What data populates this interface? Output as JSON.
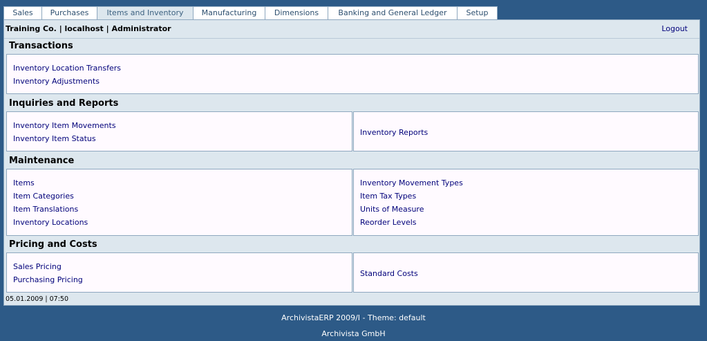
{
  "tabs": [
    "Sales",
    "Purchases",
    "Items and Inventory",
    "Manufacturing",
    "Dimensions",
    "Banking and General Ledger",
    "Setup"
  ],
  "header": {
    "company": "Training Co. | localhost | Administrator",
    "logout": "Logout"
  },
  "sections": {
    "transactions": {
      "title": "Transactions",
      "left": [
        "Inventory Location Transfers",
        "Inventory Adjustments"
      ]
    },
    "inquiries": {
      "title": "Inquiries and Reports",
      "left": [
        "Inventory Item Movements",
        "Inventory Item Status"
      ],
      "right": [
        "Inventory Reports"
      ]
    },
    "maintenance": {
      "title": "Maintenance",
      "left": [
        "Items",
        "Item Categories",
        "Item Translations",
        "Inventory Locations"
      ],
      "right": [
        "Inventory Movement Types",
        "Item Tax Types",
        "Units of Measure",
        "Reorder Levels"
      ]
    },
    "pricing": {
      "title": "Pricing and Costs",
      "left": [
        "Sales Pricing",
        "Purchasing Pricing"
      ],
      "right": [
        "Standard Costs"
      ]
    }
  },
  "footer": {
    "datetime": "05.01.2009 | 07:50",
    "version": "ArchivistaERP 2009/I - Theme: default",
    "company": "Archivista GmbH"
  }
}
